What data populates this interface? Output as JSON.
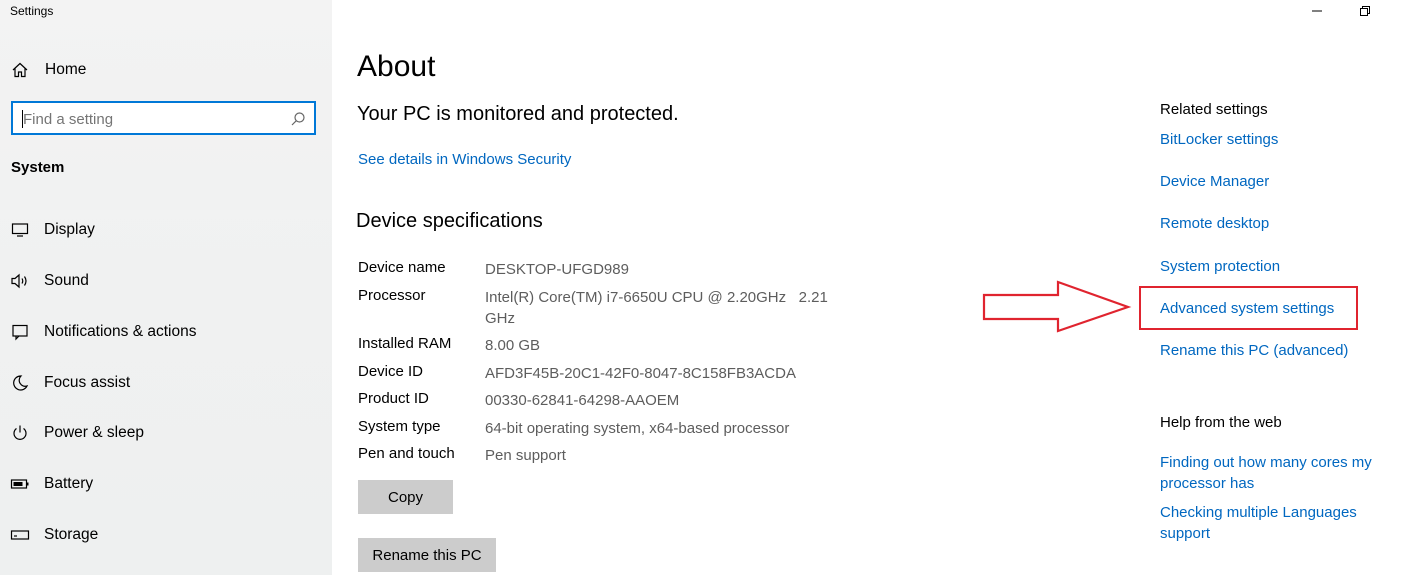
{
  "window": {
    "app_title": "Settings"
  },
  "sidebar": {
    "home_label": "Home",
    "search_placeholder": "Find a setting",
    "section_title": "System",
    "items": [
      {
        "label": "Display",
        "icon": "display-icon"
      },
      {
        "label": "Sound",
        "icon": "sound-icon"
      },
      {
        "label": "Notifications & actions",
        "icon": "notifications-icon"
      },
      {
        "label": "Focus assist",
        "icon": "focus-assist-icon"
      },
      {
        "label": "Power & sleep",
        "icon": "power-icon"
      },
      {
        "label": "Battery",
        "icon": "battery-icon"
      },
      {
        "label": "Storage",
        "icon": "storage-icon"
      }
    ]
  },
  "main": {
    "title": "About",
    "protection_text": "Your PC is monitored and protected.",
    "security_link": "See details in Windows Security",
    "spec_heading": "Device specifications",
    "specs": [
      {
        "key": "Device name",
        "value": "DESKTOP-UFGD989"
      },
      {
        "key": "Processor",
        "value": "Intel(R) Core(TM) i7-6650U CPU @ 2.20GHz   2.21 GHz"
      },
      {
        "key": "Installed RAM",
        "value": "8.00 GB"
      },
      {
        "key": "Device ID",
        "value": "AFD3F45B-20C1-42F0-8047-8C158FB3ACDA"
      },
      {
        "key": "Product ID",
        "value": "00330-62841-64298-AAOEM"
      },
      {
        "key": "System type",
        "value": "64-bit operating system, x64-based processor"
      },
      {
        "key": "Pen and touch",
        "value": "Pen support"
      }
    ],
    "copy_button": "Copy",
    "rename_button": "Rename this PC"
  },
  "related": {
    "heading": "Related settings",
    "links": [
      "BitLocker settings",
      "Device Manager",
      "Remote desktop",
      "System protection",
      "Advanced system settings",
      "Rename this PC (advanced)"
    ],
    "highlighted": "Advanced system settings",
    "highlight_color": "#e0242f"
  },
  "help": {
    "heading": "Help from the web",
    "links": [
      "Finding out how many cores my processor has",
      "Checking multiple Languages support"
    ]
  },
  "colors": {
    "accent": "#0078d7",
    "link": "#0067c0",
    "annotation": "#e0242f"
  }
}
